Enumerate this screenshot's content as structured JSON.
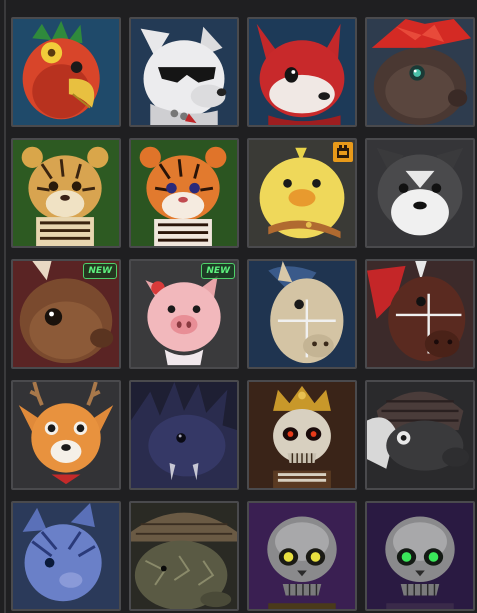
{
  "slots": [
    {
      "name": "phoenix-bird",
      "bg": "#1f4a6a",
      "badge": null
    },
    {
      "name": "white-wolf-sunglasses",
      "bg": "#233a55",
      "badge": null
    },
    {
      "name": "red-fox",
      "bg": "#1d3a58",
      "badge": null
    },
    {
      "name": "dark-boar-red-mane",
      "bg": "#2e3c4e",
      "badge": null
    },
    {
      "name": "tiger-yellow",
      "bg": "#2d5a22",
      "badge": null
    },
    {
      "name": "tiger-orange",
      "bg": "#2b5521",
      "badge": null
    },
    {
      "name": "yellow-chick",
      "bg": "#3a3a36",
      "badge": "icon"
    },
    {
      "name": "grey-husky",
      "bg": "#353538",
      "badge": null
    },
    {
      "name": "brown-squirrel",
      "bg": "#5a2424",
      "badge": "new"
    },
    {
      "name": "pink-pig",
      "bg": "#3a3a3c",
      "badge": "new"
    },
    {
      "name": "burlap-horse",
      "bg": "#1f3450",
      "badge": null
    },
    {
      "name": "dark-horse-red-mane",
      "bg": "#3c2a2a",
      "badge": null
    },
    {
      "name": "orange-deer",
      "bg": "#333336",
      "badge": null
    },
    {
      "name": "dark-spiky-beast",
      "bg": "#1e1f33",
      "badge": null
    },
    {
      "name": "crowned-skeleton",
      "bg": "#3a2418",
      "badge": null
    },
    {
      "name": "armored-skull-beast",
      "bg": "#2a2a2c",
      "badge": null
    },
    {
      "name": "blue-feathered-cat",
      "bg": "#2b3a5a",
      "badge": null
    },
    {
      "name": "armored-turtle",
      "bg": "#2a2a24",
      "badge": null
    },
    {
      "name": "skeleton-yellow-eyes",
      "bg": "#3a1f52",
      "badge": null
    },
    {
      "name": "skeleton-green-eyes",
      "bg": "#2a1a42",
      "badge": null
    }
  ],
  "badges": {
    "new_label": "NEW"
  },
  "colors": {
    "slot_border": "#4a4a4d",
    "new_badge": "#4fd06a",
    "event_badge": "#e89a1a"
  }
}
